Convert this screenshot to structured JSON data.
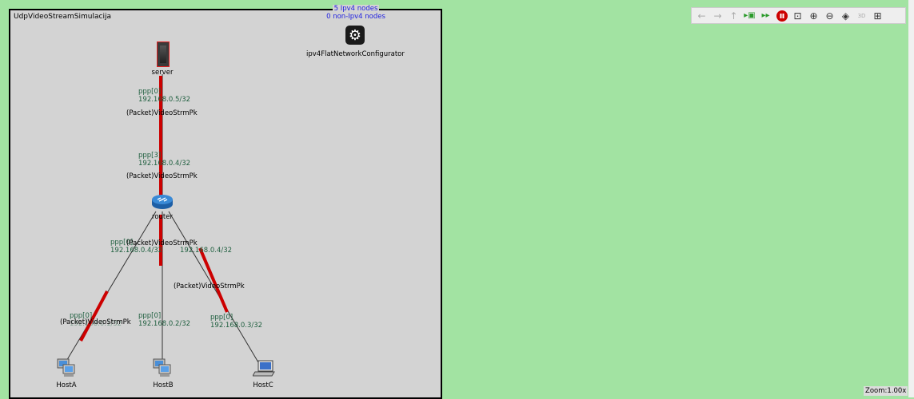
{
  "network": {
    "title": "UdpVideoStreamSimulacija",
    "ipv4_nodes": "5 Ipv4 nodes",
    "non_ipv4_nodes": "0 non-Ipv4 nodes"
  },
  "nodes": {
    "server": "server",
    "router": "router",
    "configurator": "ipv4FlatNetworkConfigurator",
    "hostA": "HostA",
    "hostB": "HostB",
    "hostC": "HostC"
  },
  "interfaces": {
    "server_ppp": "ppp[0]",
    "server_ip": "192.168.0.5/32",
    "router_up_ppp": "ppp[3]",
    "router_up_ip": "192.168.0.4/32",
    "router_a_ppp": "ppp[0]",
    "router_a_ip": "192.168.0.4/32",
    "router_c_ip": "192.168.0.4/32",
    "hostA_ppp": "ppp[0]",
    "hostA_ip": "192.168.0.1/32",
    "hostB_ppp": "ppp[0]",
    "hostB_ip": "192.168.0.2/32",
    "hostC_ppp": "ppp[0]",
    "hostC_ip": "192.168.0.3/32"
  },
  "packets": {
    "p1": "(Packet)VideoStrmPk",
    "p2": "(Packet)VideoStrmPk",
    "p3": "(Packet)VideoStrmPk",
    "p4": "(Packet)VideoStrmPk",
    "p5": "(Packet)VideoStrmPk"
  },
  "toolbar": {
    "icons": [
      "back-icon",
      "forward-icon",
      "up-icon",
      "step-icon",
      "fast-step-icon",
      "stop-icon",
      "fit-icon",
      "zoom-in-icon",
      "zoom-out-icon",
      "layers-icon",
      "3d-icon",
      "layout-icon"
    ]
  },
  "status": {
    "zoom": "Zoom:1.00x"
  },
  "colors": {
    "canvas_bg": "#a2e3a2",
    "network_bg": "#d3d3d3",
    "link_active": "#cc0000",
    "ipv4_text": "#2020e0",
    "stop_button": "#cc0000"
  }
}
